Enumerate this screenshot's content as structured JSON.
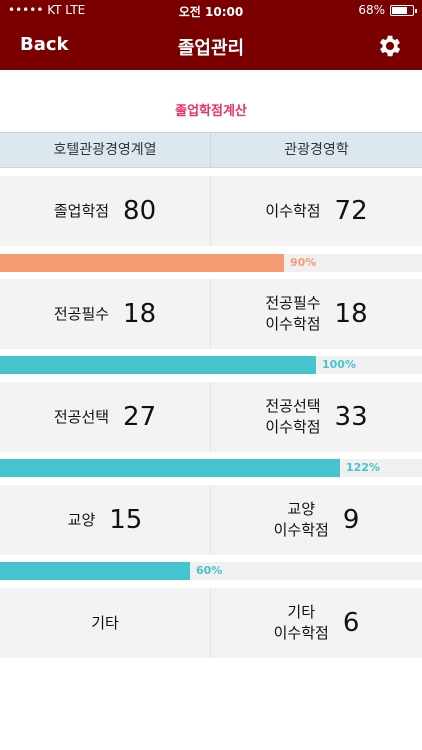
{
  "status": {
    "carrier": "••••• KT  LTE",
    "time": "오전 10:00",
    "battery_label": "68%",
    "battery_level": 0.68
  },
  "nav": {
    "back_label": "Back",
    "title": "졸업관리",
    "settings_icon": "gear-icon"
  },
  "subtitle": "졸업학점계산",
  "columns": [
    "호텔관광경영계열",
    "관광경영학"
  ],
  "rows": [
    {
      "left_label": "졸업학점",
      "left_value": "80",
      "right_label": "이수학점",
      "right_value": "72",
      "percent_label": "90%",
      "percent": 0.9,
      "bar_color": "#f59a73",
      "text_color": "#f59a73"
    },
    {
      "left_label": "전공필수",
      "left_value": "18",
      "right_label": "전공필수\n이수학점",
      "right_value": "18",
      "percent_label": "100%",
      "percent": 1.0,
      "bar_color": "#45c3cf",
      "text_color": "#45c3cf"
    },
    {
      "left_label": "전공선택",
      "left_value": "27",
      "right_label": "전공선택\n이수학점",
      "right_value": "33",
      "percent_label": "122%",
      "percent": 1.22,
      "bar_color": "#45c3cf",
      "text_color": "#45c3cf"
    },
    {
      "left_label": "교양",
      "left_value": "15",
      "right_label": "교양\n이수학점",
      "right_value": "9",
      "percent_label": "60%",
      "percent": 0.6,
      "bar_color": "#45c3cf",
      "text_color": "#45c3cf"
    },
    {
      "left_label": "기타",
      "left_value": "",
      "right_label": "기타\n이수학점",
      "right_value": "6"
    }
  ]
}
